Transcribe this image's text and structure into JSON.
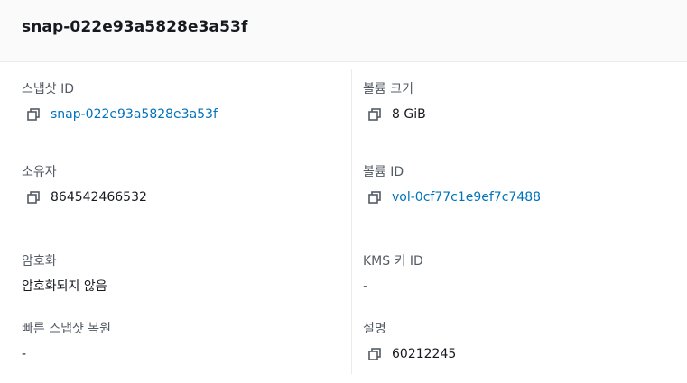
{
  "header": {
    "title": "snap-022e93a5828e3a53f"
  },
  "left": {
    "snapshot_id": {
      "label": "스냅샷 ID",
      "value": "snap-022e93a5828e3a53f"
    },
    "owner": {
      "label": "소유자",
      "value": "864542466532"
    },
    "encryption": {
      "label": "암호화",
      "value": "암호화되지 않음"
    },
    "fast_restore": {
      "label": "빠른 스냅샷 복원",
      "value": "-"
    }
  },
  "right": {
    "volume_size": {
      "label": "볼륨 크기",
      "value": "8 GiB"
    },
    "volume_id": {
      "label": "볼륨 ID",
      "value": "vol-0cf77c1e9ef7c7488"
    },
    "kms_key_id": {
      "label": "KMS 키 ID",
      "value": "-"
    },
    "description": {
      "label": "설명",
      "value": "60212245"
    }
  },
  "colors": {
    "link": "#0073bb",
    "label": "#545b64",
    "text": "#16191f",
    "header_bg": "#fafafa"
  },
  "icons": {
    "copy": "copy-icon"
  }
}
